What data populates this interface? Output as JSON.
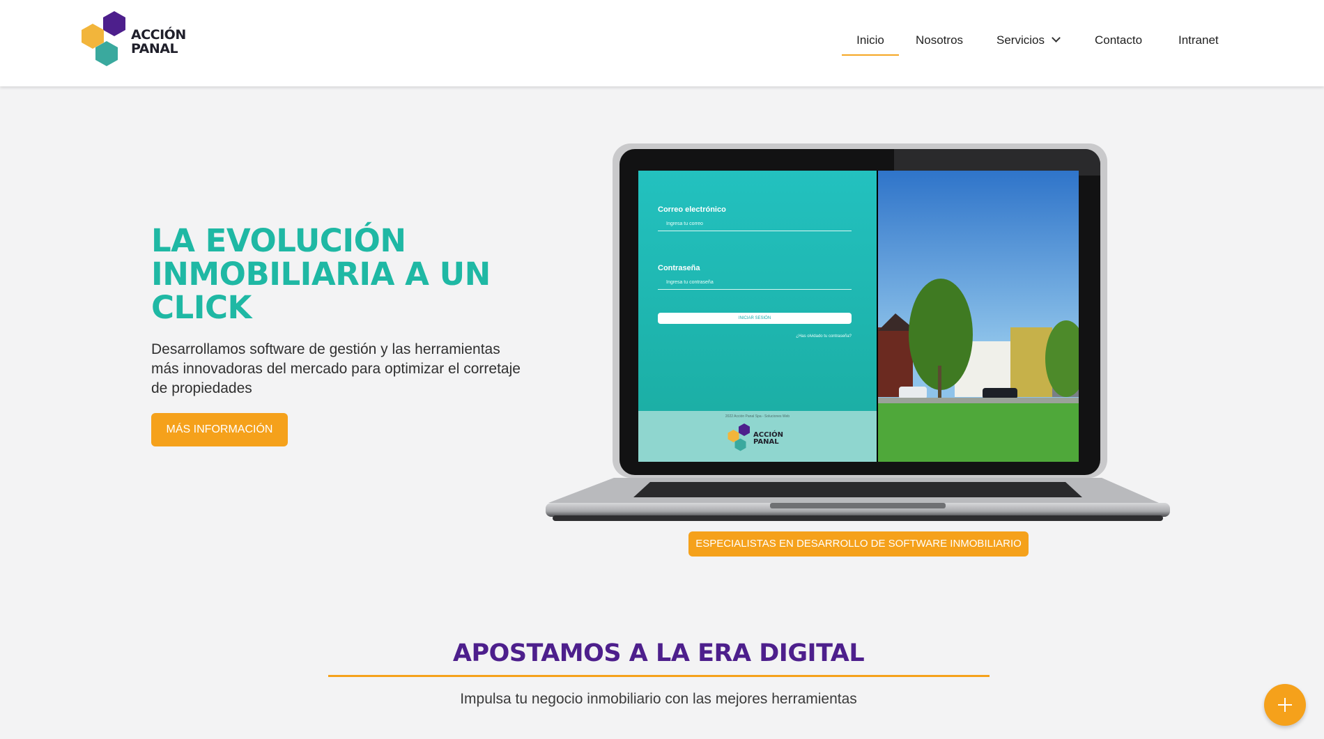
{
  "brand": {
    "line1": "ACCIÓN",
    "line2": "PANAL"
  },
  "nav": [
    {
      "label": "Inicio",
      "active": true
    },
    {
      "label": "Nosotros"
    },
    {
      "label": "Servicios",
      "has_dropdown": true
    },
    {
      "label": "Contacto"
    },
    {
      "label": "Intranet"
    }
  ],
  "hero": {
    "title": "LA EVOLUCIÓN INMOBILIARIA A UN CLICK",
    "subtitle": "Desarrollamos software de gestión y las herramientas más innovadoras del mercado para optimizar el corretaje de propiedades",
    "button": "MÁS INFORMACIÓN"
  },
  "mockup": {
    "email_label": "Correo electrónico",
    "email_placeholder": "Ingresa tu correo",
    "password_label": "Contraseña",
    "password_placeholder": "Ingresa tu contraseña",
    "login_button": "INICIAR SESIÓN",
    "forgot": "¿Has olvidado tu contraseña?",
    "footer": "2022 Acción Panal Spa - Soluciones Web",
    "logo_line1": "ACCIÓN",
    "logo_line2": "PANAL"
  },
  "badge": "ESPECIALISTAS EN DESARROLLO DE SOFTWARE INMOBILIARIO",
  "section": {
    "title": "APOSTAMOS A LA ERA DIGITAL",
    "subtitle": "Impulsa tu negocio inmobiliario con las mejores herramientas"
  },
  "fab_icon": "plus-icon",
  "colors": {
    "teal": "#1fb8a4",
    "orange": "#f5a11b",
    "purple": "#4d1f8c"
  }
}
